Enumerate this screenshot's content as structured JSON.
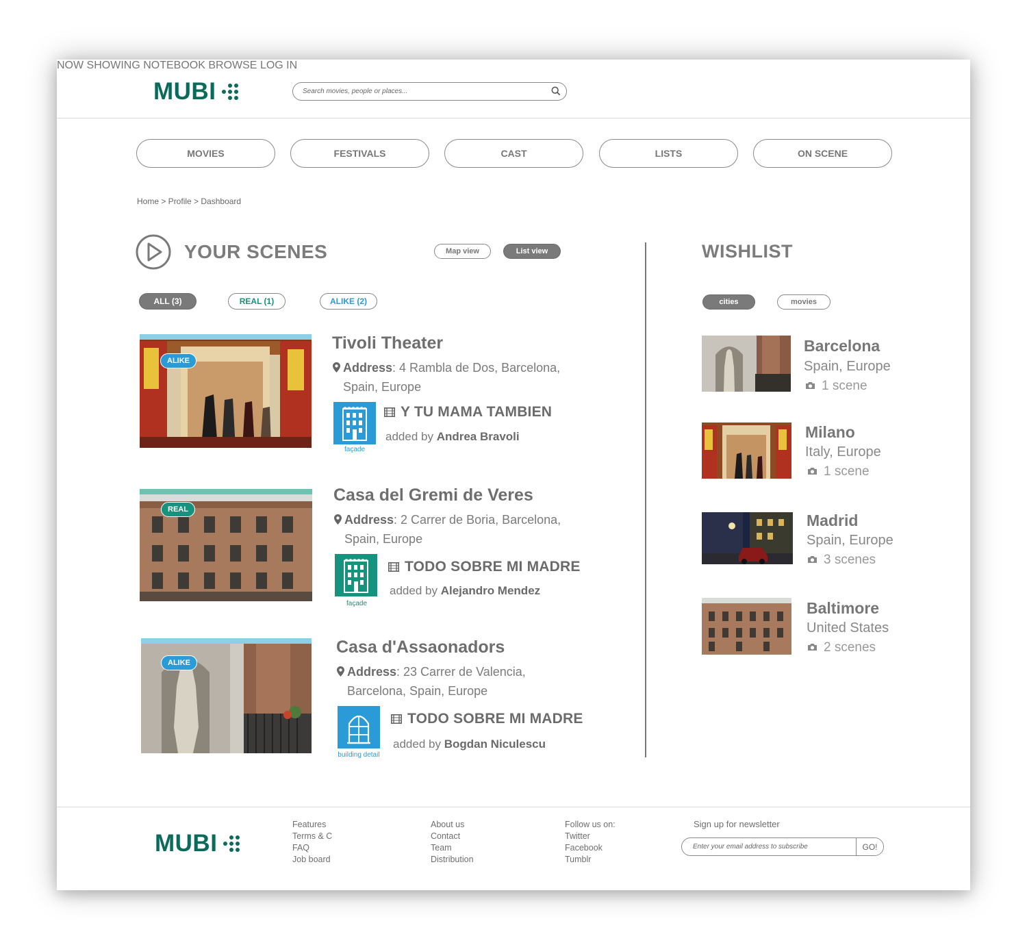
{
  "header": {
    "logo_text": "MUBI",
    "search_placeholder": "Search movies, people or places...",
    "nav": [
      "NOW SHOWING",
      "NOTEBOOK",
      "BROWSE",
      "LOG IN"
    ]
  },
  "tabs": [
    "MOVIES",
    "FESTIVALS",
    "CAST",
    "LISTS",
    "ON SCENE"
  ],
  "breadcrumb": "Home > Profile > Dashboard",
  "scenes": {
    "title": "YOUR SCENES",
    "view_toggle": {
      "map": "Map view",
      "list": "List view",
      "active": "list"
    },
    "filters": [
      "ALL (3)",
      "REAL (1)",
      "ALIKE (2)"
    ],
    "items": [
      {
        "badge": "ALIKE",
        "title": "Tivoli Theater",
        "address_label": "Address",
        "address_line1": ": 4 Rambla de Dos, Barcelona,",
        "address_line2": "Spain, Europe",
        "category": "façade",
        "movie": "Y TU MAMA TAMBIEN",
        "added_by_prefix": "added by",
        "added_by": "Andrea Bravoli"
      },
      {
        "badge": "REAL",
        "title": "Casa del Gremi de Veres",
        "address_label": "Address",
        "address_line1": ": 2 Carrer de Boria, Barcelona,",
        "address_line2": "Spain, Europe",
        "category": "façade",
        "movie": "TODO SOBRE MI MADRE",
        "added_by_prefix": "added by",
        "added_by": "Alejandro Mendez"
      },
      {
        "badge": "ALIKE",
        "title": "Casa d'Assaonadors",
        "address_label": "Address",
        "address_line1": ": 23 Carrer de Valencia,",
        "address_line2": "Barcelona, Spain, Europe",
        "category": "building detail",
        "movie": "TODO SOBRE MI MADRE",
        "added_by_prefix": "added by",
        "added_by": "Bogdan Niculescu"
      }
    ]
  },
  "wishlist": {
    "title": "WISHLIST",
    "filters": [
      "cities",
      "movies"
    ],
    "active_filter": "cities",
    "items": [
      {
        "city": "Barcelona",
        "region": "Spain, Europe",
        "count": "1 scene"
      },
      {
        "city": "Milano",
        "region": "Italy, Europe",
        "count": "1 scene"
      },
      {
        "city": "Madrid",
        "region": "Spain, Europe",
        "count": "3 scenes"
      },
      {
        "city": "Baltimore",
        "region": "United States",
        "count": "2 scenes"
      }
    ]
  },
  "footer": {
    "logo_text": "MUBI",
    "col1": [
      "Features",
      "Terms & C",
      "FAQ",
      "Job board"
    ],
    "col2": [
      "About us",
      "Contact",
      "Team",
      "Distribution"
    ],
    "col3": [
      "Follow us on:",
      "Twitter",
      "Facebook",
      "Tumblr"
    ],
    "newsletter_label": "Sign up for newsletter",
    "newsletter_placeholder": "Enter your email address to subscribe",
    "newsletter_button": "GO!"
  },
  "colors": {
    "brand": "#0b6b5b",
    "alike": "#2a9bd6",
    "real": "#16927e",
    "pill_dark": "#7a7a7a"
  }
}
